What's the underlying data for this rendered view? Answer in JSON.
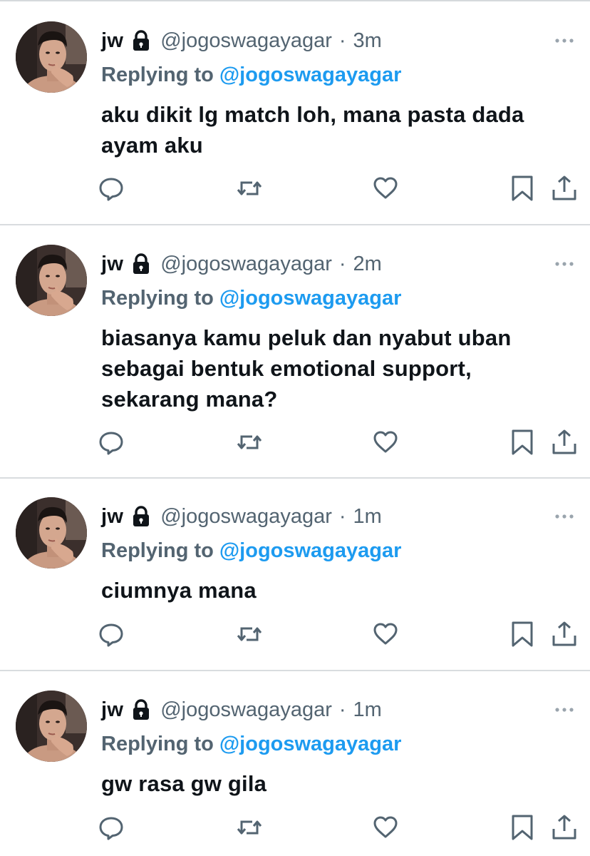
{
  "icons": {
    "lock": "lock-icon",
    "more": "more-horizontal-icon",
    "reply": "reply-bubble-icon",
    "retweet": "retweet-icon",
    "like": "heart-icon",
    "bookmark": "bookmark-icon",
    "share": "share-upload-icon"
  },
  "colors": {
    "text": "#0f1419",
    "secondary": "#536471",
    "accent": "#1d9bf0",
    "divider": "#d9dcdf"
  },
  "tweets": [
    {
      "name": "jw",
      "handle": "@jogoswagayagar",
      "separator": "·",
      "time": "3m",
      "replying_label": "Replying to",
      "replying_to": "@jogoswagayagar",
      "text": "aku dikit lg match loh, mana pasta dada ayam aku"
    },
    {
      "name": "jw",
      "handle": "@jogoswagayagar",
      "separator": "·",
      "time": "2m",
      "replying_label": "Replying to",
      "replying_to": "@jogoswagayagar",
      "text": "biasanya kamu peluk dan nyabut uban sebagai bentuk emotional support, sekarang mana?"
    },
    {
      "name": "jw",
      "handle": "@jogoswagayagar",
      "separator": "·",
      "time": "1m",
      "replying_label": "Replying to",
      "replying_to": "@jogoswagayagar",
      "text": "ciumnya mana"
    },
    {
      "name": "jw",
      "handle": "@jogoswagayagar",
      "separator": "·",
      "time": "1m",
      "replying_label": "Replying to",
      "replying_to": "@jogoswagayagar",
      "text": "gw rasa gw gila"
    }
  ]
}
